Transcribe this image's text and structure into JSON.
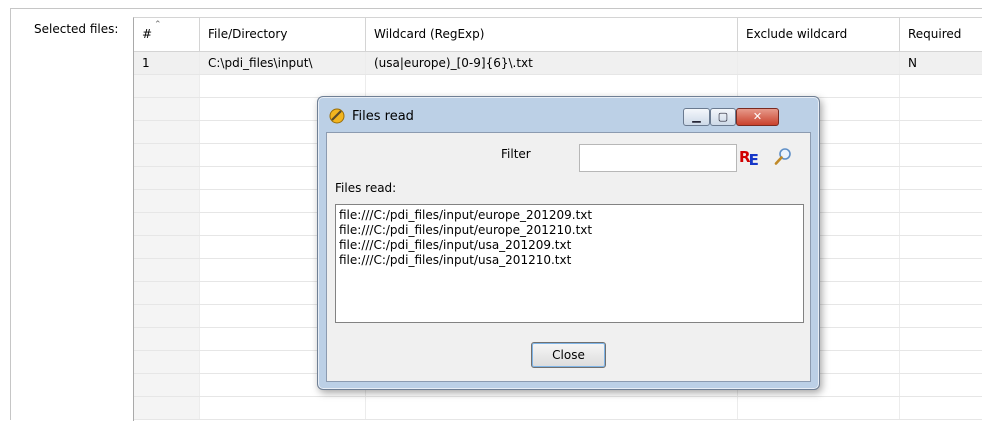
{
  "selected_files_label": "Selected files:",
  "table": {
    "columns": [
      {
        "label": "#"
      },
      {
        "label": "File/Directory"
      },
      {
        "label": "Wildcard (RegExp)"
      },
      {
        "label": "Exclude wildcard"
      },
      {
        "label": "Required"
      }
    ],
    "rows": [
      {
        "num": "1",
        "file": "C:\\pdi_files\\input\\",
        "wildcard": "(usa|europe)_[0-9]{6}\\.txt",
        "exclude": "",
        "required": "N"
      }
    ]
  },
  "dialog": {
    "title": "Files read",
    "filter_label": "Filter",
    "filter_value": "",
    "files_read_label": "Files read:",
    "files": [
      "file:///C:/pdi_files/input/europe_201209.txt",
      "file:///C:/pdi_files/input/europe_201210.txt",
      "file:///C:/pdi_files/input/usa_201209.txt",
      "file:///C:/pdi_files/input/usa_201210.txt"
    ],
    "close_label": "Close",
    "icons": {
      "window": "spoon-icon",
      "minimize": "minimize-icon",
      "maximize": "maximize-icon",
      "close": "close-icon",
      "regex": "regex-icon",
      "search": "search-icon"
    },
    "title_buttons": {
      "minimize": "▁",
      "maximize": "▢",
      "close": "✕"
    },
    "regex_glyph": {
      "r": "R",
      "e": "E"
    }
  }
}
